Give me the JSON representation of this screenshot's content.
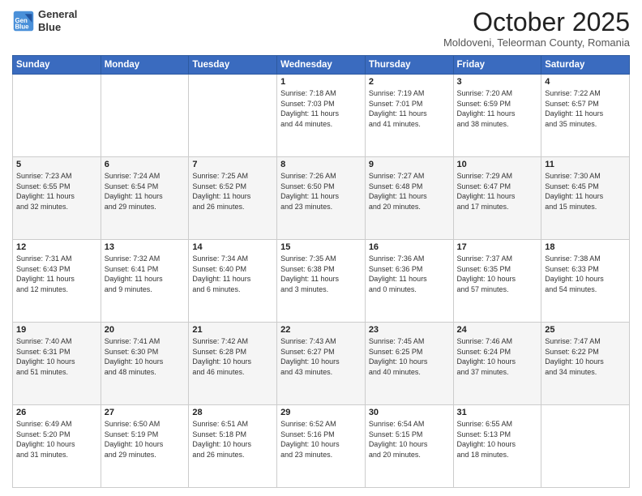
{
  "logo": {
    "line1": "General",
    "line2": "Blue"
  },
  "header": {
    "month": "October 2025",
    "location": "Moldoveni, Teleorman County, Romania"
  },
  "days_of_week": [
    "Sunday",
    "Monday",
    "Tuesday",
    "Wednesday",
    "Thursday",
    "Friday",
    "Saturday"
  ],
  "weeks": [
    [
      {
        "day": "",
        "info": ""
      },
      {
        "day": "",
        "info": ""
      },
      {
        "day": "",
        "info": ""
      },
      {
        "day": "1",
        "info": "Sunrise: 7:18 AM\nSunset: 7:03 PM\nDaylight: 11 hours\nand 44 minutes."
      },
      {
        "day": "2",
        "info": "Sunrise: 7:19 AM\nSunset: 7:01 PM\nDaylight: 11 hours\nand 41 minutes."
      },
      {
        "day": "3",
        "info": "Sunrise: 7:20 AM\nSunset: 6:59 PM\nDaylight: 11 hours\nand 38 minutes."
      },
      {
        "day": "4",
        "info": "Sunrise: 7:22 AM\nSunset: 6:57 PM\nDaylight: 11 hours\nand 35 minutes."
      }
    ],
    [
      {
        "day": "5",
        "info": "Sunrise: 7:23 AM\nSunset: 6:55 PM\nDaylight: 11 hours\nand 32 minutes."
      },
      {
        "day": "6",
        "info": "Sunrise: 7:24 AM\nSunset: 6:54 PM\nDaylight: 11 hours\nand 29 minutes."
      },
      {
        "day": "7",
        "info": "Sunrise: 7:25 AM\nSunset: 6:52 PM\nDaylight: 11 hours\nand 26 minutes."
      },
      {
        "day": "8",
        "info": "Sunrise: 7:26 AM\nSunset: 6:50 PM\nDaylight: 11 hours\nand 23 minutes."
      },
      {
        "day": "9",
        "info": "Sunrise: 7:27 AM\nSunset: 6:48 PM\nDaylight: 11 hours\nand 20 minutes."
      },
      {
        "day": "10",
        "info": "Sunrise: 7:29 AM\nSunset: 6:47 PM\nDaylight: 11 hours\nand 17 minutes."
      },
      {
        "day": "11",
        "info": "Sunrise: 7:30 AM\nSunset: 6:45 PM\nDaylight: 11 hours\nand 15 minutes."
      }
    ],
    [
      {
        "day": "12",
        "info": "Sunrise: 7:31 AM\nSunset: 6:43 PM\nDaylight: 11 hours\nand 12 minutes."
      },
      {
        "day": "13",
        "info": "Sunrise: 7:32 AM\nSunset: 6:41 PM\nDaylight: 11 hours\nand 9 minutes."
      },
      {
        "day": "14",
        "info": "Sunrise: 7:34 AM\nSunset: 6:40 PM\nDaylight: 11 hours\nand 6 minutes."
      },
      {
        "day": "15",
        "info": "Sunrise: 7:35 AM\nSunset: 6:38 PM\nDaylight: 11 hours\nand 3 minutes."
      },
      {
        "day": "16",
        "info": "Sunrise: 7:36 AM\nSunset: 6:36 PM\nDaylight: 11 hours\nand 0 minutes."
      },
      {
        "day": "17",
        "info": "Sunrise: 7:37 AM\nSunset: 6:35 PM\nDaylight: 10 hours\nand 57 minutes."
      },
      {
        "day": "18",
        "info": "Sunrise: 7:38 AM\nSunset: 6:33 PM\nDaylight: 10 hours\nand 54 minutes."
      }
    ],
    [
      {
        "day": "19",
        "info": "Sunrise: 7:40 AM\nSunset: 6:31 PM\nDaylight: 10 hours\nand 51 minutes."
      },
      {
        "day": "20",
        "info": "Sunrise: 7:41 AM\nSunset: 6:30 PM\nDaylight: 10 hours\nand 48 minutes."
      },
      {
        "day": "21",
        "info": "Sunrise: 7:42 AM\nSunset: 6:28 PM\nDaylight: 10 hours\nand 46 minutes."
      },
      {
        "day": "22",
        "info": "Sunrise: 7:43 AM\nSunset: 6:27 PM\nDaylight: 10 hours\nand 43 minutes."
      },
      {
        "day": "23",
        "info": "Sunrise: 7:45 AM\nSunset: 6:25 PM\nDaylight: 10 hours\nand 40 minutes."
      },
      {
        "day": "24",
        "info": "Sunrise: 7:46 AM\nSunset: 6:24 PM\nDaylight: 10 hours\nand 37 minutes."
      },
      {
        "day": "25",
        "info": "Sunrise: 7:47 AM\nSunset: 6:22 PM\nDaylight: 10 hours\nand 34 minutes."
      }
    ],
    [
      {
        "day": "26",
        "info": "Sunrise: 6:49 AM\nSunset: 5:20 PM\nDaylight: 10 hours\nand 31 minutes."
      },
      {
        "day": "27",
        "info": "Sunrise: 6:50 AM\nSunset: 5:19 PM\nDaylight: 10 hours\nand 29 minutes."
      },
      {
        "day": "28",
        "info": "Sunrise: 6:51 AM\nSunset: 5:18 PM\nDaylight: 10 hours\nand 26 minutes."
      },
      {
        "day": "29",
        "info": "Sunrise: 6:52 AM\nSunset: 5:16 PM\nDaylight: 10 hours\nand 23 minutes."
      },
      {
        "day": "30",
        "info": "Sunrise: 6:54 AM\nSunset: 5:15 PM\nDaylight: 10 hours\nand 20 minutes."
      },
      {
        "day": "31",
        "info": "Sunrise: 6:55 AM\nSunset: 5:13 PM\nDaylight: 10 hours\nand 18 minutes."
      },
      {
        "day": "",
        "info": ""
      }
    ]
  ]
}
